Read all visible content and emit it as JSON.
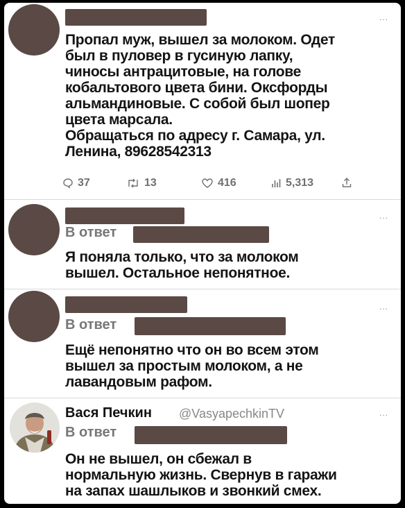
{
  "tweets": [
    {
      "text_lines": [
        "Пропал муж, вышел за молоком. Одет",
        "был в пуловер в гусиную лапку,",
        "чиносы антрацитовые, на голове",
        "кобальтового цвета бини. Оксфорды",
        "альмандиновые. С собой был шопер",
        "цвета марсала.",
        "Обращаться по адресу г. Самара, ул.",
        "Ленина, 89628542313"
      ],
      "actions": {
        "replies": "37",
        "retweets": "13",
        "likes": "416",
        "views": "5,313"
      }
    },
    {
      "reply_label": "В ответ",
      "text_lines": [
        "Я поняла только, что за молоком",
        "вышел. Остальное непонятное."
      ]
    },
    {
      "reply_label": "В ответ",
      "text_lines": [
        "Ещё непонятно что он во всем этом",
        "вышел за простым молоком, а не",
        "лавандовым рафом."
      ]
    },
    {
      "author_name": "Вася Печкин",
      "author_handle": "@VasyapechkinTV",
      "reply_label": "В ответ",
      "text_lines": [
        "Он не вышел, он сбежал в",
        "нормальную жизнь. Свернув в гаражи",
        "на запах шашлыков и звонкий смех."
      ]
    }
  ],
  "more_glyph": "...",
  "colors": {
    "redaction": "#5a4944",
    "muted": "#777777"
  }
}
